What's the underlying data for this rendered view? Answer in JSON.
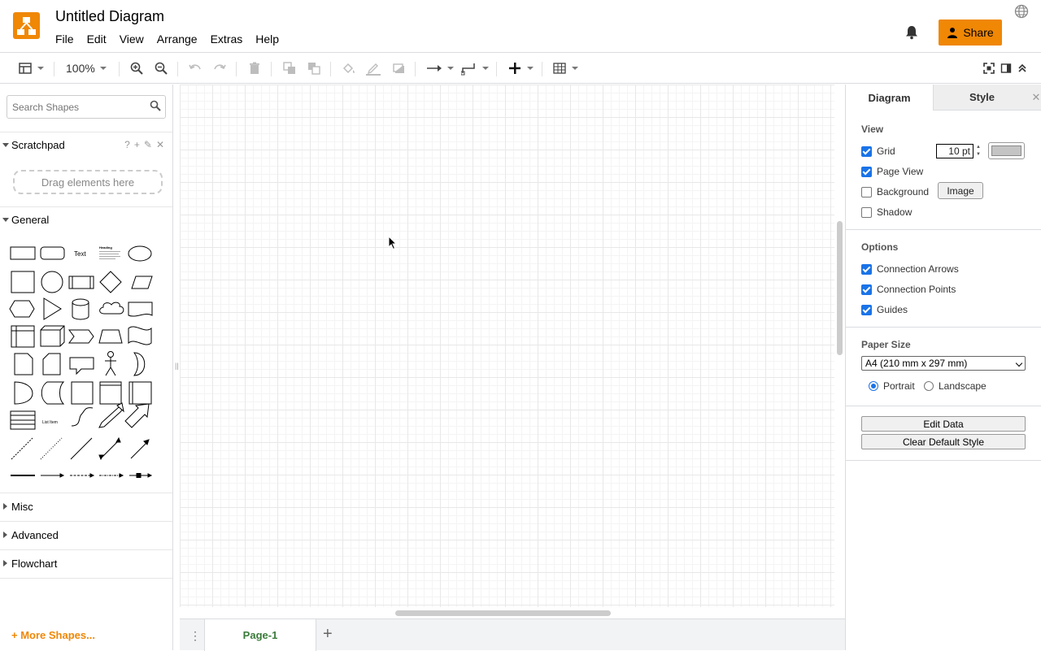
{
  "header": {
    "title": "Untitled Diagram",
    "menus": [
      "File",
      "Edit",
      "View",
      "Arrange",
      "Extras",
      "Help"
    ],
    "share_label": "Share"
  },
  "toolbar": {
    "zoom": "100%"
  },
  "sidebar": {
    "search_placeholder": "Search Shapes",
    "scratchpad_label": "Scratchpad",
    "scratchpad_help": "?",
    "dropzone_label": "Drag elements here",
    "general_label": "General",
    "shape_text_label": "Text",
    "shape_heading_label": "Heading",
    "shape_list_label": "List Item",
    "misc_label": "Misc",
    "advanced_label": "Advanced",
    "flowchart_label": "Flowchart",
    "more_shapes_label": "More Shapes..."
  },
  "pages": {
    "tabs": [
      "Page-1"
    ]
  },
  "format_panel": {
    "tabs": [
      "Diagram",
      "Style"
    ],
    "view_heading": "View",
    "grid_label": "Grid",
    "grid_size": "10 pt",
    "grid_checked": true,
    "page_view_label": "Page View",
    "page_view_checked": true,
    "background_label": "Background",
    "background_checked": false,
    "image_button": "Image",
    "shadow_label": "Shadow",
    "shadow_checked": false,
    "options_heading": "Options",
    "connection_arrows_label": "Connection Arrows",
    "connection_points_label": "Connection Points",
    "guides_label": "Guides",
    "paper_size_heading": "Paper Size",
    "paper_size_value": "A4 (210 mm x 297 mm)",
    "portrait_label": "Portrait",
    "landscape_label": "Landscape",
    "orientation": "Portrait",
    "edit_data_button": "Edit Data",
    "clear_style_button": "Clear Default Style"
  },
  "colors": {
    "brand": "#f08705",
    "accent": "#1a73e8",
    "page_tab_text": "#3a7a3a"
  }
}
